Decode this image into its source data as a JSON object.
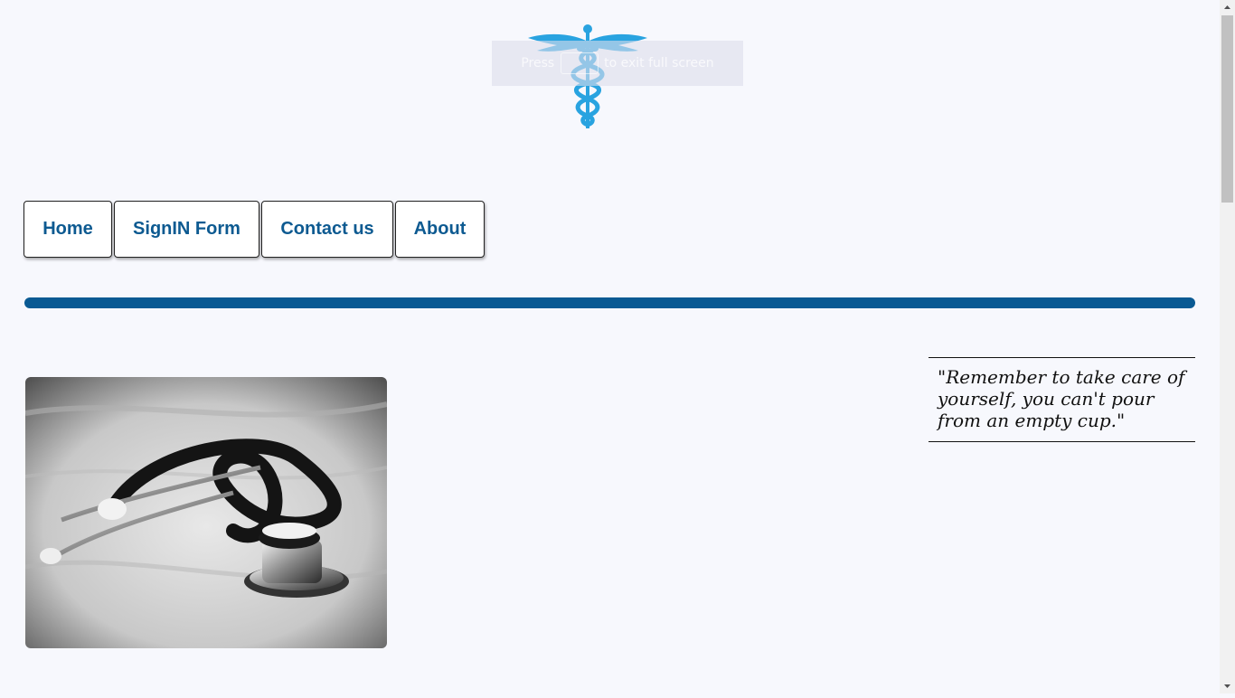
{
  "header": {
    "logo_icon": "caduceus-icon",
    "logo_color": "#29a3e0",
    "fullscreen_toast": {
      "prefix": "Press",
      "suffix": "to exit full screen"
    }
  },
  "nav": {
    "items": [
      {
        "label": "Home"
      },
      {
        "label": "SignIN Form"
      },
      {
        "label": "Contact us"
      },
      {
        "label": "About"
      }
    ],
    "text_color": "#0d5a91"
  },
  "divider_color": "#0a5a93",
  "main": {
    "image": {
      "icon": "stethoscope-photo"
    },
    "quote": "\"Remember to take care of yourself, you can't pour from an empty cup.\""
  },
  "scrollbar": {
    "up_icon": "scroll-up-arrow-icon",
    "down_icon": "scroll-down-arrow-icon"
  }
}
